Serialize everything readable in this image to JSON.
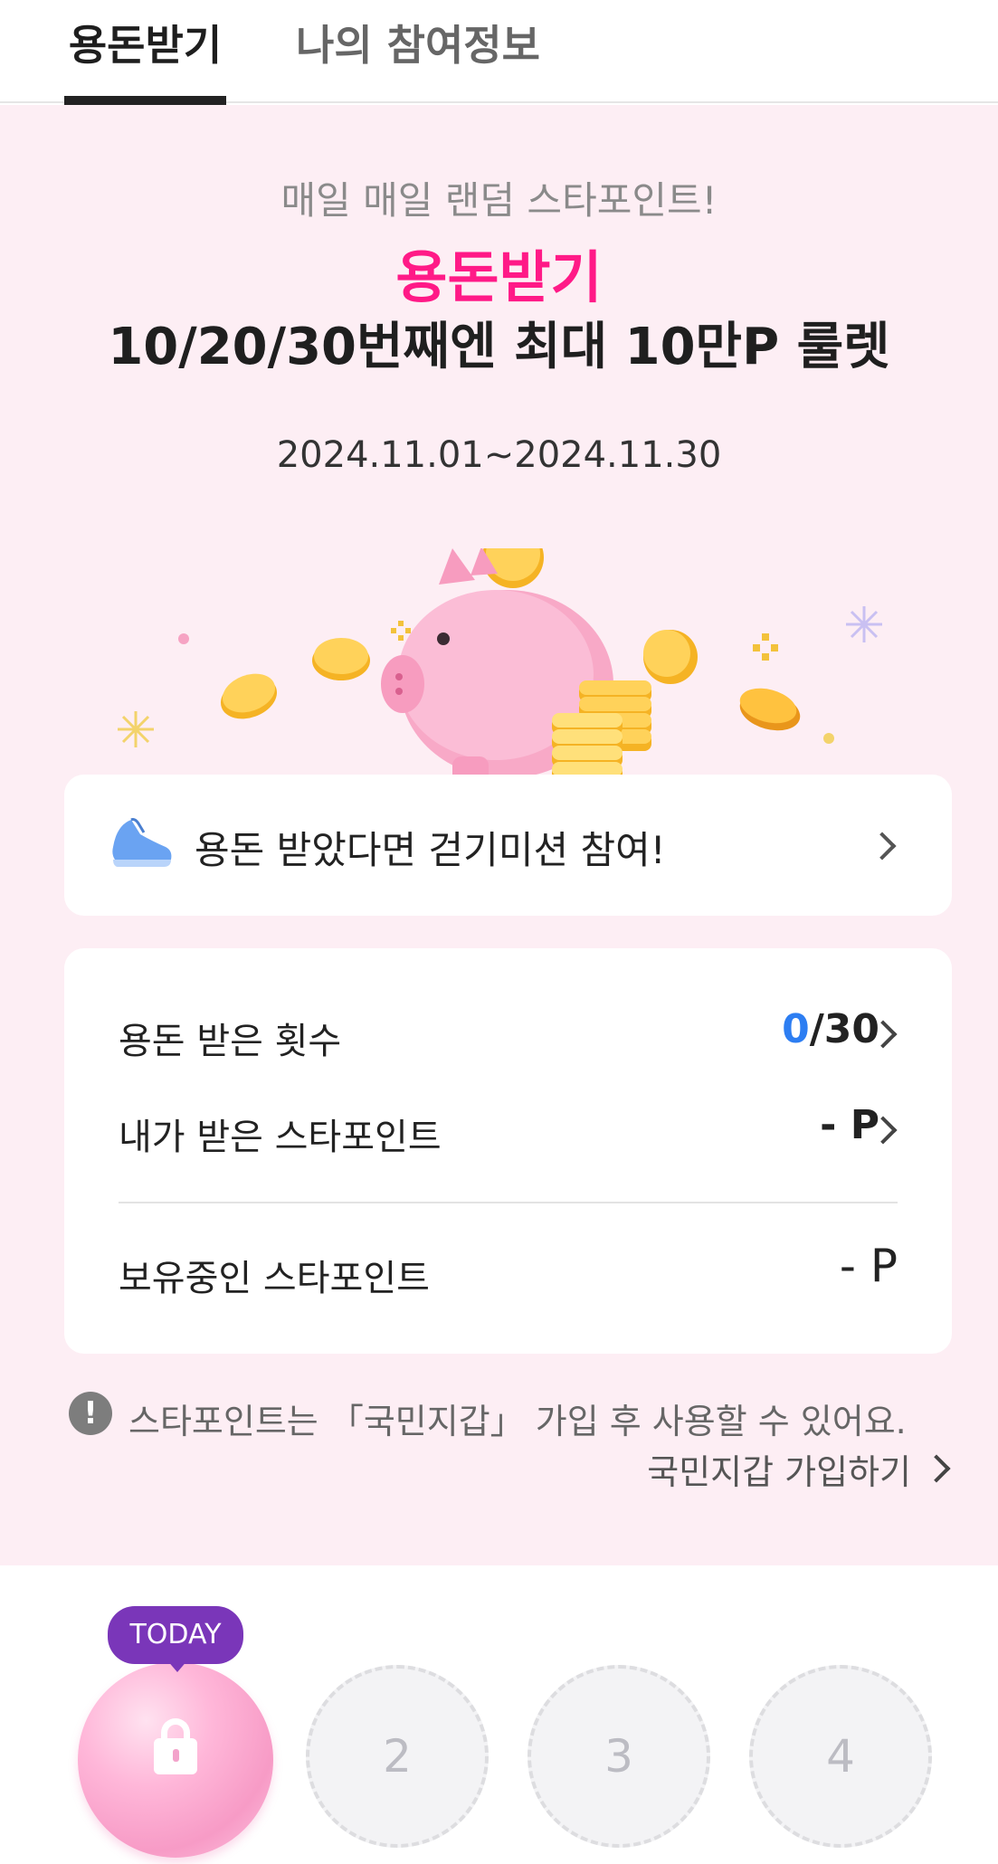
{
  "tabs": [
    {
      "label": "용돈받기",
      "active": true
    },
    {
      "label": "나의 참여정보",
      "active": false
    }
  ],
  "hero": {
    "subtitle": "매일 매일 랜덤 스타포인트!",
    "title_highlight": "용돈받기",
    "title_main": "10/20/30번째엔 최대 10만P 룰렛",
    "period": "2024.11.01~2024.11.30"
  },
  "walk_mission": {
    "label": "용돈 받았다면 걷기미션 참여!",
    "icon": "sneaker-icon"
  },
  "stats": {
    "received_count_label": "용돈 받은 횟수",
    "received_count_current": "0",
    "received_count_total": "/30",
    "received_points_label": "내가 받은 스타포인트",
    "received_points_value": "- P",
    "holding_points_label": "보유중인 스타포인트",
    "holding_points_value": "- P"
  },
  "notice": {
    "icon": "exclamation-icon",
    "text": "스타포인트는 「국민지갑」 가입 후 사용할 수 있어요.",
    "join_link": "국민지갑 가입하기"
  },
  "calendar": {
    "today_badge": "TODAY",
    "days": [
      "2",
      "3",
      "4"
    ]
  },
  "colors": {
    "hero_bg": "#fdeef4",
    "highlight_pink": "#ff1a87",
    "count_blue": "#2d7ef2",
    "today_badge": "#7a36b9"
  }
}
